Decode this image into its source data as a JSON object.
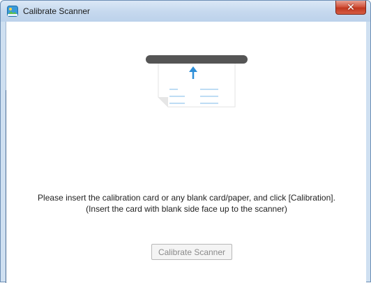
{
  "window": {
    "title": "Calibrate Scanner",
    "close_glyph": "✕",
    "icon": "scanner-app-icon"
  },
  "main": {
    "illustration_icon": "scanner-insert-paper-icon",
    "message_line1": "Please insert the calibration card or any blank card/paper, and click [Calibration].",
    "message_line2": "(Insert the card with blank side face up to the scanner)",
    "calibrate_button_label": "Calibrate Scanner",
    "calibrate_button_enabled": false
  },
  "colors": {
    "titlebar": "#c5d8ee",
    "close_button": "#c0371f",
    "accent_blue": "#2f8fd8"
  }
}
